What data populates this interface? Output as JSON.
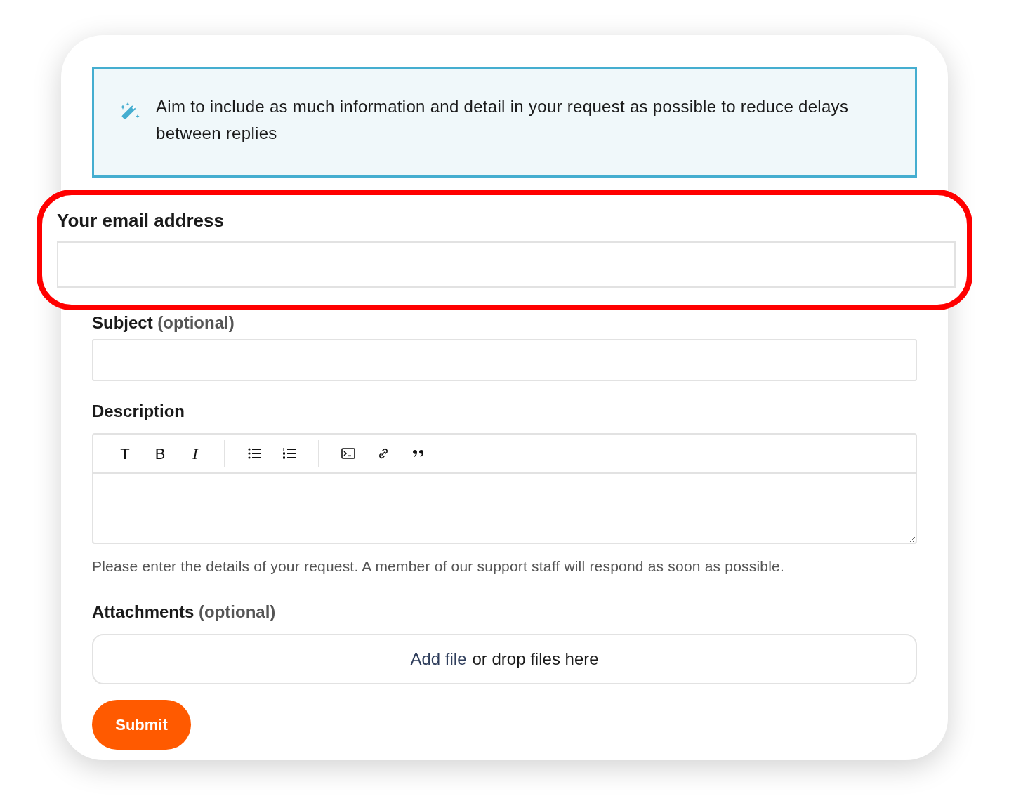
{
  "notice": {
    "text": "Aim to include as much information and detail in your request as possible to reduce delays between replies"
  },
  "email": {
    "label": "Your email address",
    "highlighted": true
  },
  "subject": {
    "label": "Subject",
    "suffix": "(optional)"
  },
  "description": {
    "label": "Description",
    "toolbar": [
      {
        "kind": "heading",
        "label": "T"
      },
      {
        "kind": "bold",
        "label": "B"
      },
      {
        "kind": "italic",
        "label": "I"
      },
      {
        "kind": "bullets"
      },
      {
        "kind": "numbers"
      },
      {
        "kind": "code"
      },
      {
        "kind": "link"
      },
      {
        "kind": "quote"
      }
    ],
    "hint": "Please enter the details of your request. A member of our support staff will respond as soon as possible."
  },
  "attachments": {
    "label": "Attachments",
    "suffix": "(optional)",
    "link": "Add file",
    "text": "or drop files here"
  },
  "submit": "Submit"
}
